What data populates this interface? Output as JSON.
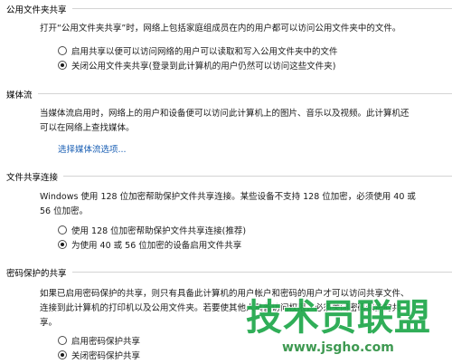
{
  "public_folder_sharing": {
    "title": "公用文件夹共享",
    "description": "打开“公用文件夹共享”时，网络上包括家庭组成员在内的用户都可以访问公用文件夹中的文件。",
    "options": [
      {
        "label": "启用共享以便可以访问网络的用户可以读取和写入公用文件夹中的文件",
        "checked": false
      },
      {
        "label": "关闭公用文件夹共享(登录到此计算机的用户仍然可以访问这些文件夹)",
        "checked": true
      }
    ]
  },
  "media_streaming": {
    "title": "媒体流",
    "description_line1": "当媒体流启用时，网络上的用户和设备便可以访问此计算机上的图片、音乐以及视频。此计算机还",
    "description_line2": "可以在网络上查找媒体。",
    "link": "选择媒体流选项..."
  },
  "file_sharing_connections": {
    "title": "文件共享连接",
    "description_line1": "Windows 使用 128 位加密帮助保护文件共享连接。某些设备不支持 128 位加密，必须使用 40 或",
    "description_line2": "56 位加密。",
    "options": [
      {
        "label": "使用 128 位加密帮助保护文件共享连接(推荐)",
        "checked": false
      },
      {
        "label": "为使用 40 或 56 位加密的设备启用文件共享",
        "checked": true
      }
    ]
  },
  "password_protected_sharing": {
    "title": "密码保护的共享",
    "description_line1": "如果已启用密码保护的共享，则只有具备此计算机的用户帐户和密码的用户才可以访问共享文件、",
    "description_line2": "连接到此计算机的打印机以及公用文件夹。若要使其他人具备访问权限，必须关闭密码保护的共",
    "description_line3": "享。",
    "options": [
      {
        "label": "启用密码保护共享",
        "checked": false
      },
      {
        "label": "关闭密码保护共享",
        "checked": true
      }
    ]
  },
  "watermark": {
    "text": "技术员联盟",
    "url": "www.jsgho.com"
  }
}
